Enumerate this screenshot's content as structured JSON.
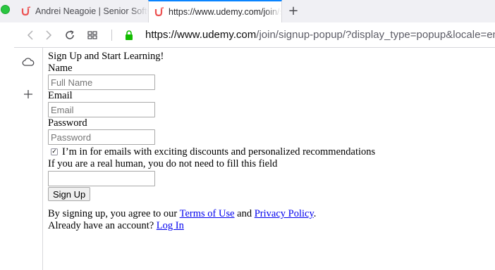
{
  "browser": {
    "tabs": [
      {
        "title": "Andrei Neagoie | Senior Software Developer"
      },
      {
        "title": "https://www.udemy.com/join/signup-popup/"
      }
    ],
    "new_tab_symbol": "+",
    "url": {
      "host": "https://www.udemy.com",
      "path": "/join/signup-popup/?display_type=popup&locale=en_"
    },
    "accent_color": "#0a84ff",
    "brand_color": "#ec5252"
  },
  "sidebar": {
    "icons": [
      "cloud-icon",
      "plus-icon"
    ]
  },
  "form": {
    "heading": "Sign Up and Start Learning!",
    "name_label": "Name",
    "name_placeholder": "Full Name",
    "email_label": "Email",
    "email_placeholder": "Email",
    "password_label": "Password",
    "password_placeholder": "Password",
    "optin_checked": true,
    "optin_label": "I’m in for emails with exciting discounts and personalized recommendations",
    "honeypot_label": "If you are a real human, you do not need to fill this field",
    "honeypot_value": "",
    "submit_label": "Sign Up",
    "terms_prefix": "By signing up, you agree to our",
    "terms_link": "Terms of Use",
    "terms_and": "and",
    "privacy_link": "Privacy Policy",
    "terms_suffix": ".",
    "login_prefix": "Already have an account?",
    "login_link": "Log In"
  }
}
